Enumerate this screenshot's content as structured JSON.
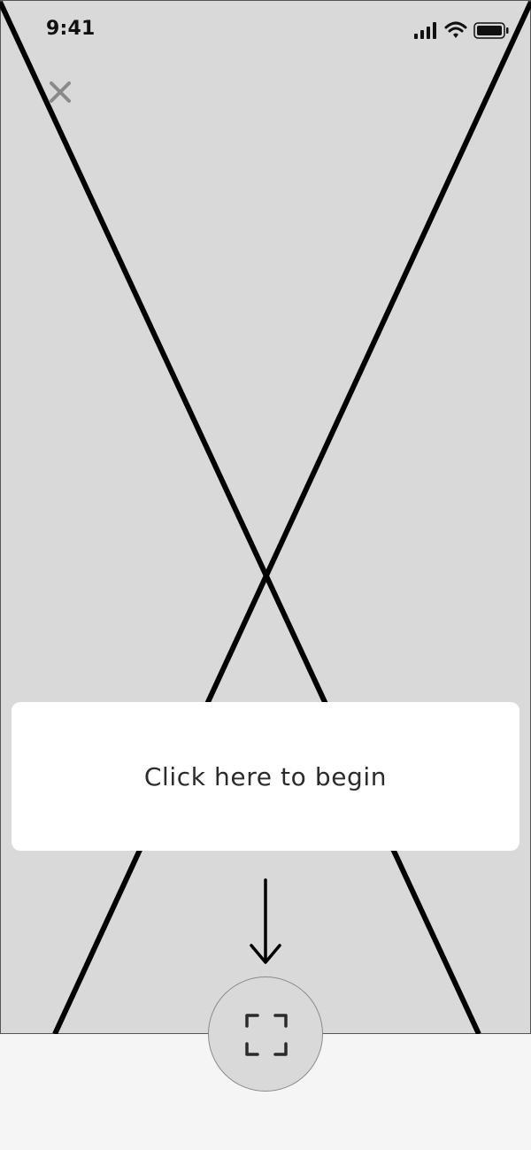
{
  "status_bar": {
    "time": "9:41",
    "icons": [
      "signal-icon",
      "wifi-icon",
      "battery-icon"
    ]
  },
  "toolbar": {
    "close_icon": "close-icon"
  },
  "prompt": {
    "label": "Click here to begin"
  },
  "scan_button": {
    "icon": "scan-frame-icon"
  },
  "colors": {
    "background": "#d9d9d9",
    "card": "#ffffff",
    "bottom_panel": "#f5f5f5",
    "lines": "#000000",
    "close_icon": "#8a8a8a"
  }
}
